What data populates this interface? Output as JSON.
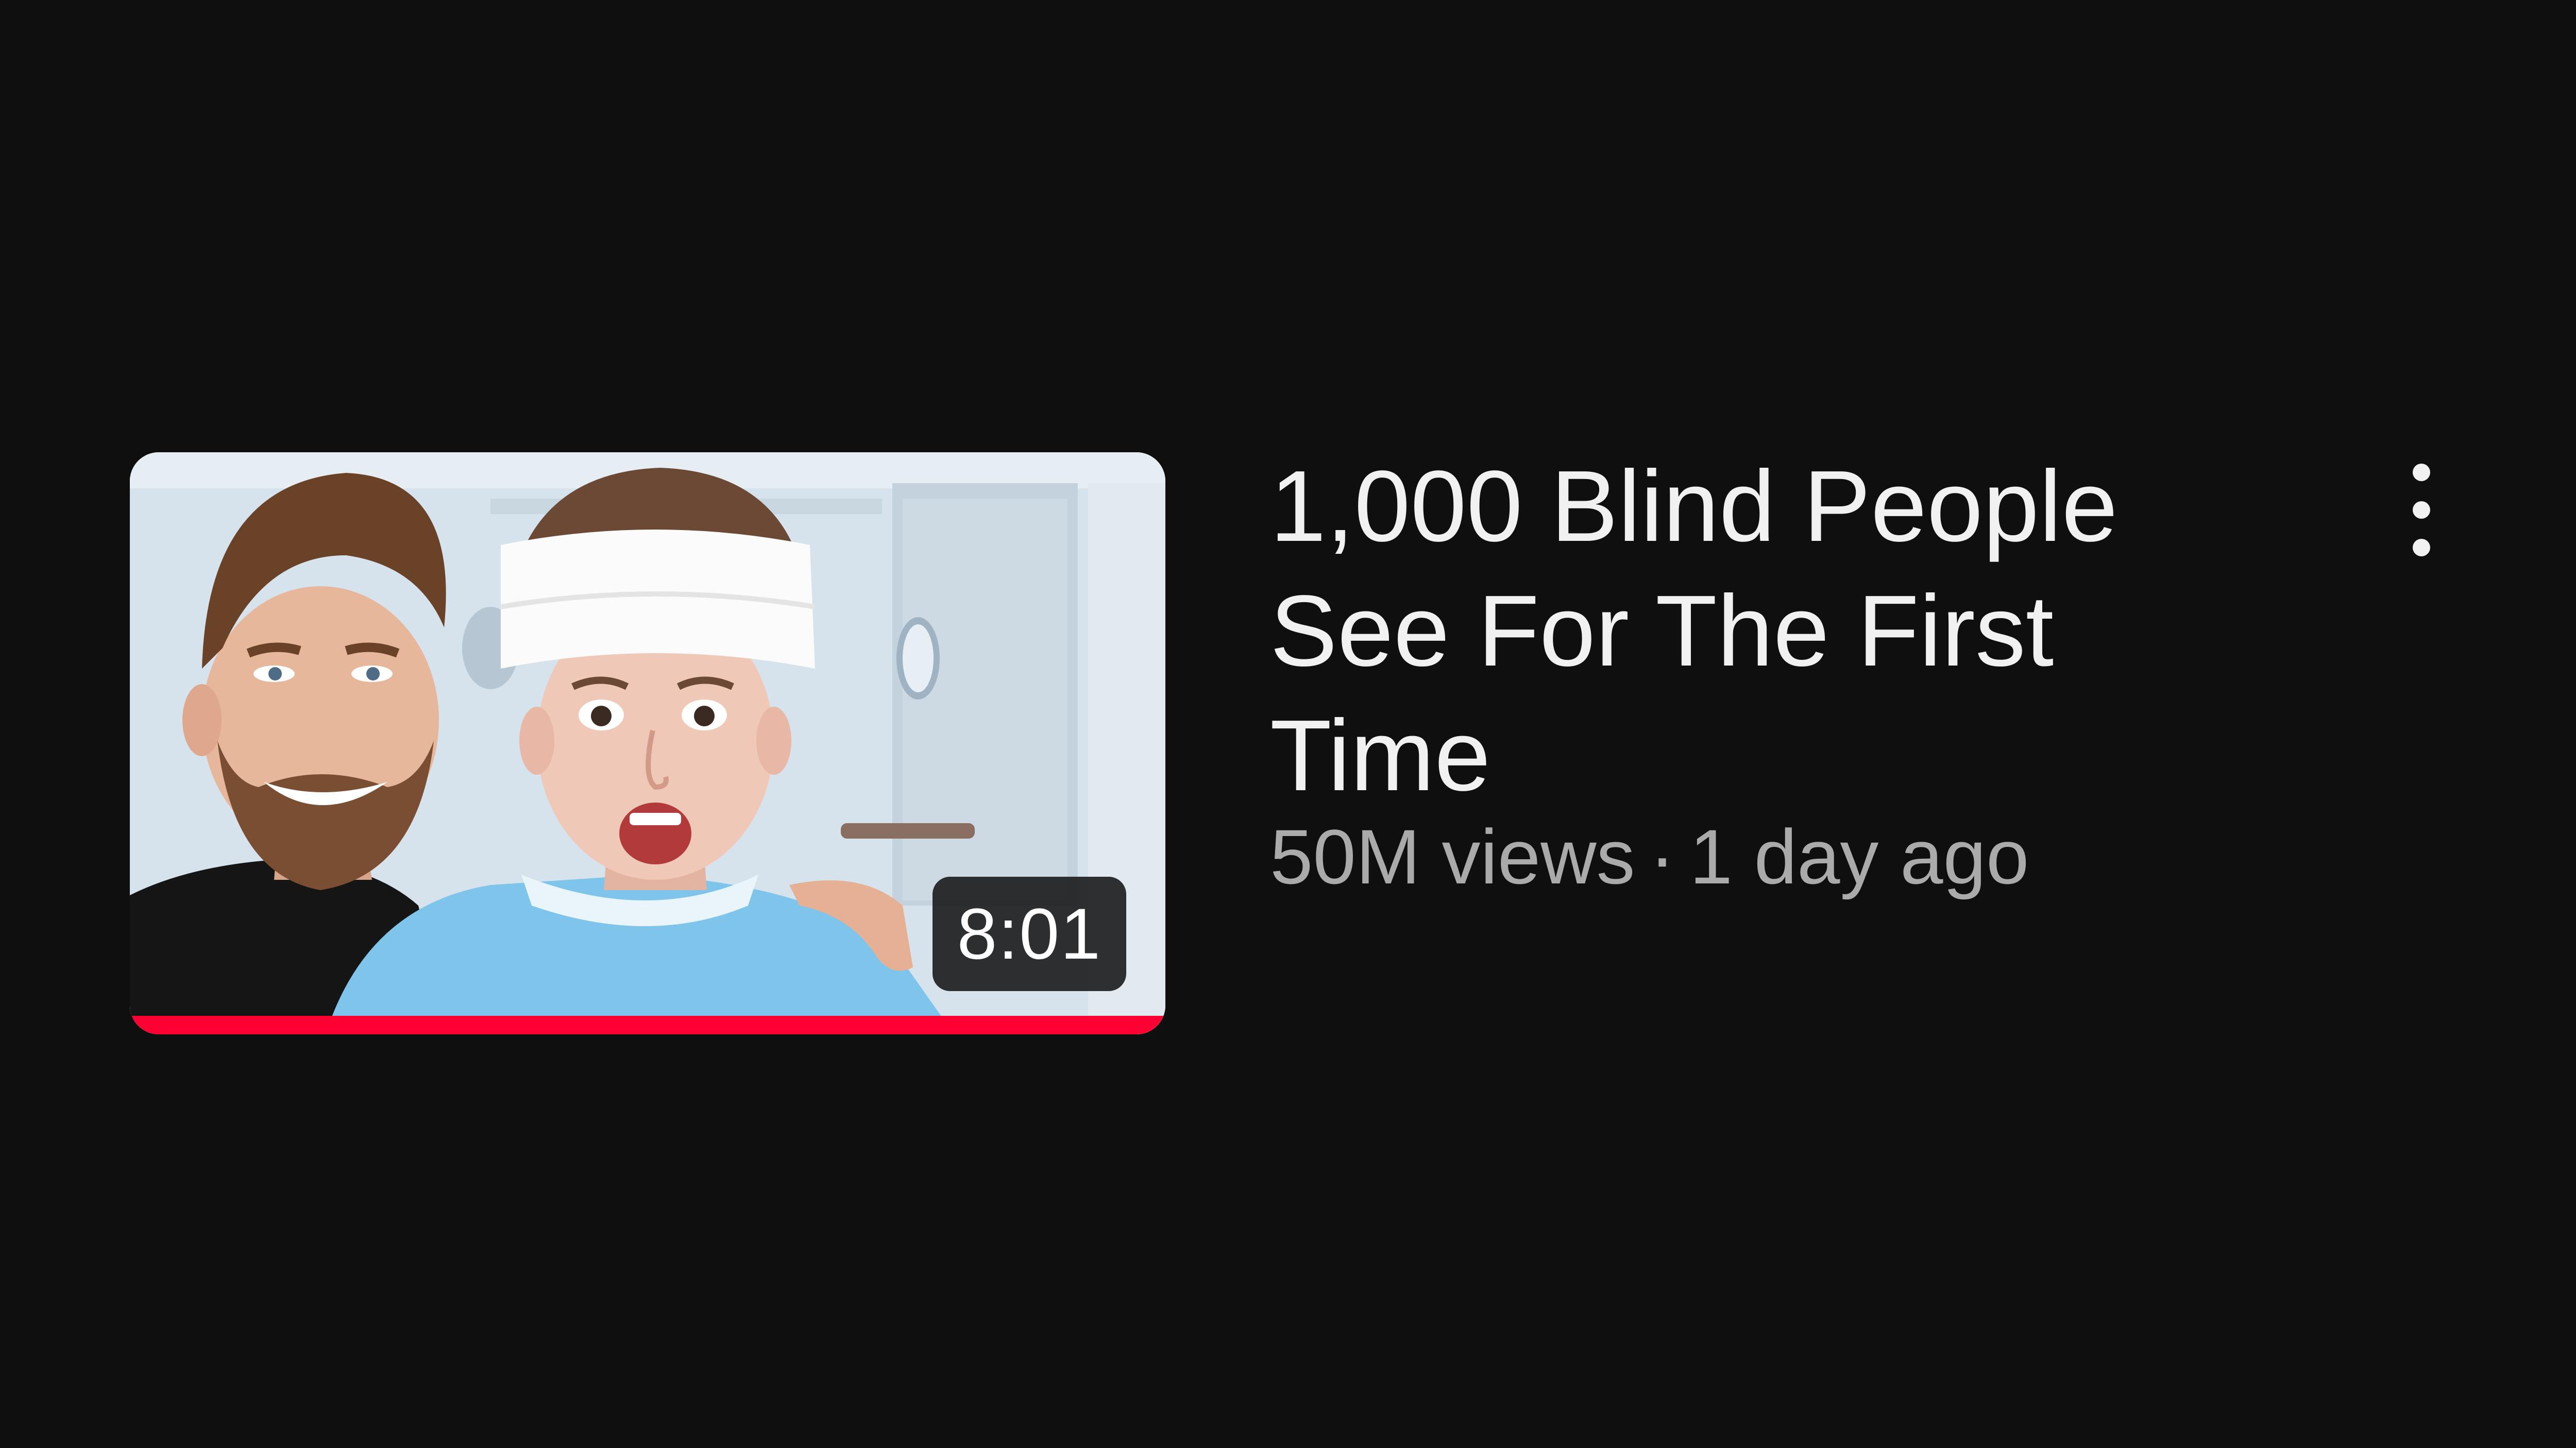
{
  "video": {
    "title": "1,000 Blind People See For The First Time",
    "views": "50M views",
    "separator": "·",
    "age": "1 day ago",
    "duration": "8:01",
    "watch_progress": 1.0
  },
  "icons": {
    "more": "more-vert-icon"
  },
  "colors": {
    "background": "#0f0f0f",
    "title": "#f1f1f1",
    "subtitle": "#aaaaaa",
    "progress": "#ff0033"
  }
}
